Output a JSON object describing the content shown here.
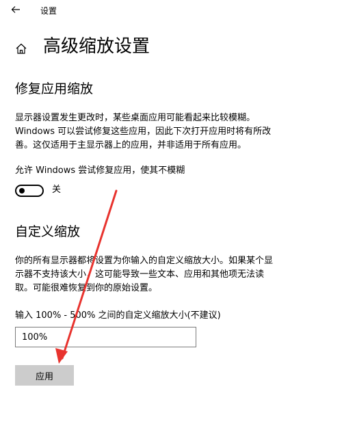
{
  "window": {
    "title": "设置"
  },
  "page": {
    "title": "高级缩放设置"
  },
  "fix_scaling": {
    "heading": "修复应用缩放",
    "description_lines": [
      "显示器设置发生更改时，某些桌面应用可能看起来比较模糊。",
      "Windows 可以尝试修复这些应用，因此下次打开应用时将有所改",
      "善。这仅适用于主显示器上的应用，并非适用于所有应用。"
    ],
    "toggle_label": "允许 Windows 尝试修复应用，使其不模糊",
    "toggle_state": "关",
    "toggle_on": false
  },
  "custom_scaling": {
    "heading": "自定义缩放",
    "description_lines": [
      "你的所有显示器都将设置为你输入的自定义缩放大小。如果某个显",
      "示器不支持该大小，这可能导致一些文本、应用和其他项无法读",
      "取。可能很难恢复到你的原始设置。"
    ],
    "input_label": "输入 100% - 500% 之间的自定义缩放大小(不建议)",
    "input_value": "100%",
    "apply_label": "应用"
  },
  "annotation": {
    "arrow_color": "#e8332e"
  }
}
